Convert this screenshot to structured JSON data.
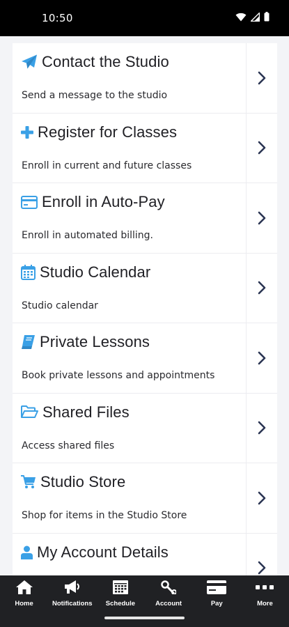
{
  "status_bar": {
    "time": "10:50"
  },
  "colors": {
    "accent": "#3aa0e6",
    "chevron": "#2b3553",
    "nav_bg": "#202124"
  },
  "menu": [
    {
      "icon": "send-icon",
      "title": "Contact the Studio",
      "description": "Send a message to the studio"
    },
    {
      "icon": "plus-icon",
      "title": "Register for Classes",
      "description": "Enroll in current and future classes"
    },
    {
      "icon": "credit-card-icon",
      "title": "Enroll in Auto-Pay",
      "description": "Enroll in automated billing."
    },
    {
      "icon": "calendar-icon",
      "title": "Studio Calendar",
      "description": "Studio calendar"
    },
    {
      "icon": "book-icon",
      "title": "Private Lessons",
      "description": "Book private lessons and appointments"
    },
    {
      "icon": "folder-open-icon",
      "title": "Shared Files",
      "description": "Access shared files"
    },
    {
      "icon": "cart-icon",
      "title": "Studio Store",
      "description": "Shop for items in the Studio Store"
    },
    {
      "icon": "user-icon",
      "title": "My Account Details",
      "description": ""
    }
  ],
  "bottom_nav": [
    {
      "icon": "home-icon",
      "label": "Home"
    },
    {
      "icon": "megaphone-icon",
      "label": "Notifications"
    },
    {
      "icon": "schedule-icon",
      "label": "Schedule"
    },
    {
      "icon": "account-icon",
      "label": "Account"
    },
    {
      "icon": "pay-icon",
      "label": "Pay"
    },
    {
      "icon": "more-icon",
      "label": "More"
    }
  ]
}
